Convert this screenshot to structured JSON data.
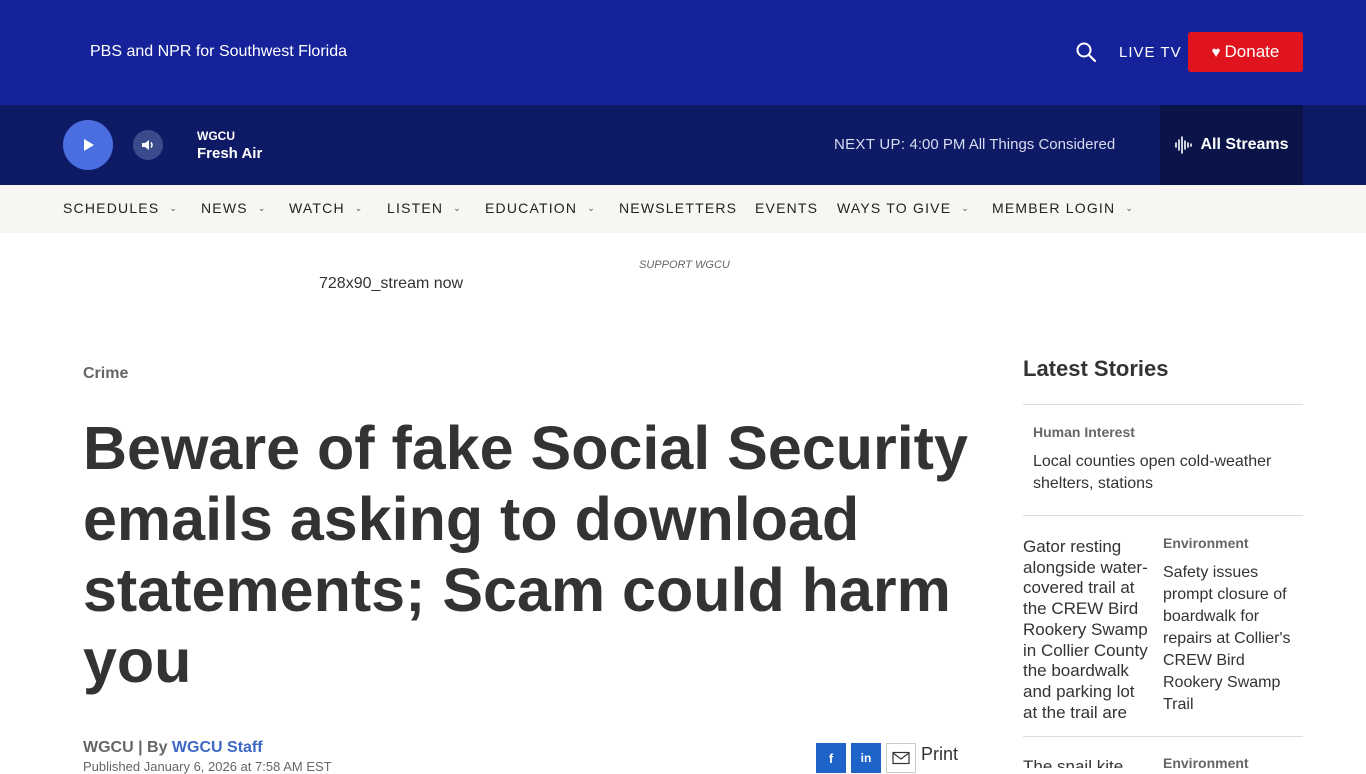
{
  "header": {
    "tagline": "PBS and NPR for Southwest Florida",
    "live_tv": "LIVE TV",
    "donate": "Donate"
  },
  "player": {
    "station": "WGCU",
    "program": "Fresh Air",
    "next_up_label": "NEXT UP:",
    "next_up_time": "4:00 PM",
    "next_up_show": "All Things Considered",
    "all_streams": "All Streams"
  },
  "nav": {
    "items": [
      {
        "label": "SCHEDULES"
      },
      {
        "label": "NEWS"
      },
      {
        "label": "WATCH"
      },
      {
        "label": "LISTEN"
      },
      {
        "label": "EDUCATION"
      },
      {
        "label": "NEWSLETTERS"
      },
      {
        "label": "EVENTS"
      },
      {
        "label": "WAYS TO GIVE"
      },
      {
        "label": "MEMBER LOGIN"
      }
    ]
  },
  "ad": {
    "support_label": "SUPPORT WGCU",
    "image_alt": "728x90_stream now"
  },
  "article": {
    "category": "Crime",
    "headline": "Beware of fake Social Security emails asking to download statements; Scam could harm you",
    "source": "WGCU | By ",
    "author": "WGCU Staff",
    "published": "Published January 6, 2026 at 7:58 AM EST",
    "share": {
      "facebook": "f",
      "linkedin": "in",
      "print": "Print"
    }
  },
  "sidebar": {
    "title": "Latest Stories",
    "stories": [
      {
        "category": "Human Interest",
        "title": "Local counties open cold-weather shelters, stations"
      },
      {
        "category": "Environment",
        "title": "Safety issues prompt closure of boardwalk for repairs at Collier's CREW Bird Rookery Swamp Trail",
        "image_alt": "Gator resting alongside water-covered trail at the CREW Bird Rookery Swamp in Collier County the boardwalk and parking lot at the trail are"
      },
      {
        "category": "Environment",
        "image_alt": "The snail kite"
      }
    ]
  },
  "colors": {
    "header_bg": "#16229a",
    "player_bg": "#0f1a66",
    "donate": "#e0141e",
    "link": "#3e68c4"
  }
}
